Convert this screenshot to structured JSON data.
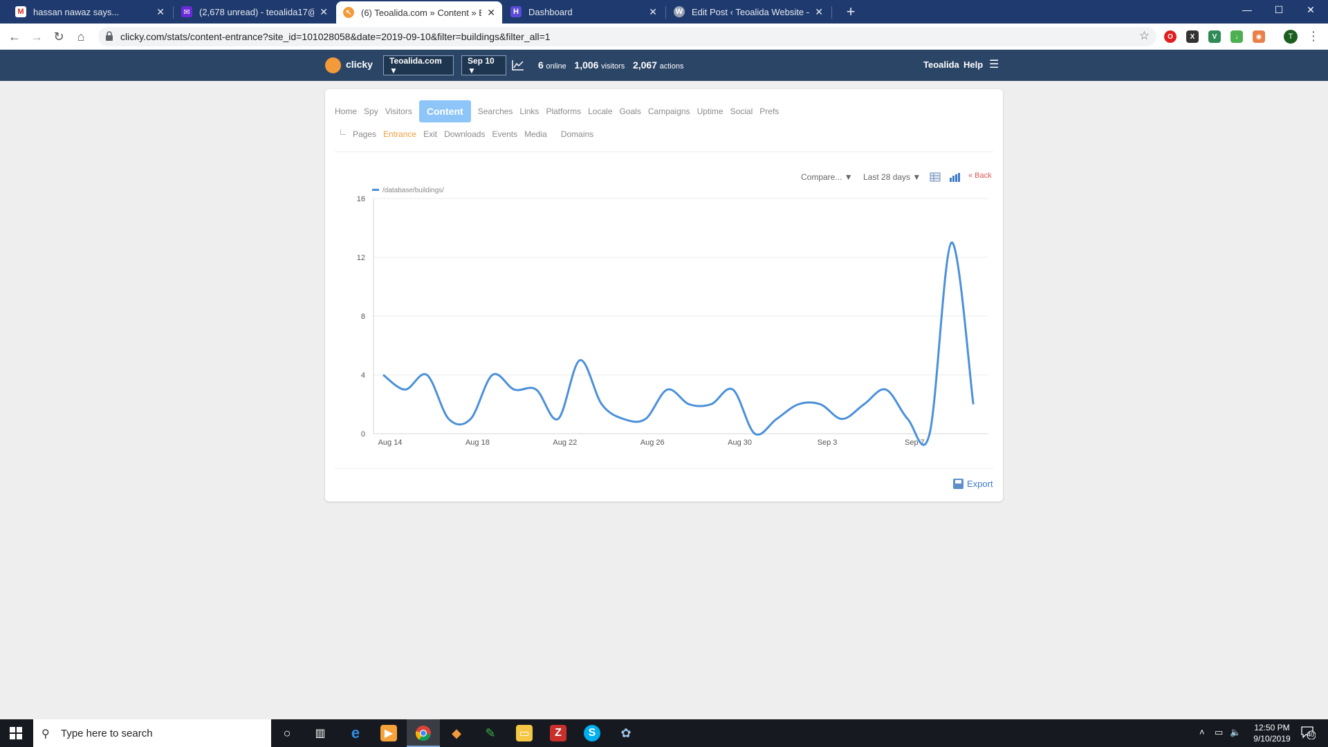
{
  "browser": {
    "tabs": [
      {
        "title": "hassan nawaz says...",
        "favicon": "gmail-icon"
      },
      {
        "title": "(2,678 unread) - teoalida17@yah",
        "favicon": "yahoo-mail-icon"
      },
      {
        "title": "(6) Teoalida.com » Content » Entr",
        "favicon": "clicky-icon"
      },
      {
        "title": "Dashboard",
        "favicon": "dashboard-icon"
      },
      {
        "title": "Edit Post ‹ Teoalida Website — W",
        "favicon": "wordpress-icon"
      }
    ],
    "url": "clicky.com/stats/content-entrance?site_id=101028058&date=2019-09-10&filter=buildings&filter_all=1",
    "profile_initial": "T"
  },
  "header": {
    "brand": "clicky",
    "site_selector": "Teoalida.com ▼",
    "date_selector": "Sep 10 ▼",
    "online_count": "6",
    "online_label": "online",
    "visitors_count": "1,006",
    "visitors_label": "visitors",
    "actions_count": "2,067",
    "actions_label": "actions",
    "user": "Teoalida",
    "help": "Help"
  },
  "nav": {
    "primary": [
      "Home",
      "Spy",
      "Visitors"
    ],
    "active": "Content",
    "primary_after": [
      "Searches",
      "Links",
      "Platforms",
      "Locale",
      "Goals",
      "Campaigns",
      "Uptime",
      "Social",
      "Prefs"
    ],
    "secondary": [
      "Pages",
      "Entrance",
      "Exit",
      "Downloads",
      "Events",
      "Media",
      "Domains"
    ],
    "secondary_active": "Entrance"
  },
  "chart_controls": {
    "compare": "Compare... ▼",
    "range": "Last 28 days ▼",
    "back": "« Back"
  },
  "export_label": "Export",
  "colors": {
    "line": "#4a90d9",
    "header_bg": "#2b4566",
    "active_tab": "#8ec5f8",
    "subnav_active": "#f29d3c"
  },
  "chart_data": {
    "type": "line",
    "series": [
      {
        "name": "/database/buildings/",
        "values": [
          4,
          3,
          4,
          1,
          1,
          4,
          3,
          3,
          1,
          5,
          2,
          1,
          1,
          3,
          2,
          2,
          3,
          0,
          1,
          2,
          2,
          1,
          2,
          3,
          1,
          0,
          13,
          2
        ]
      }
    ],
    "x_tick_labels": [
      "Aug 14",
      "Aug 18",
      "Aug 22",
      "Aug 26",
      "Aug 30",
      "Sep 3",
      "Sep 7"
    ],
    "y_ticks": [
      0,
      4,
      8,
      12,
      16
    ],
    "ylim": [
      0,
      16
    ],
    "grid": true,
    "legend": "top-left"
  },
  "taskbar": {
    "search_placeholder": "Type here to search",
    "time": "12:50 PM",
    "date": "9/10/2019",
    "notifications": "40"
  }
}
